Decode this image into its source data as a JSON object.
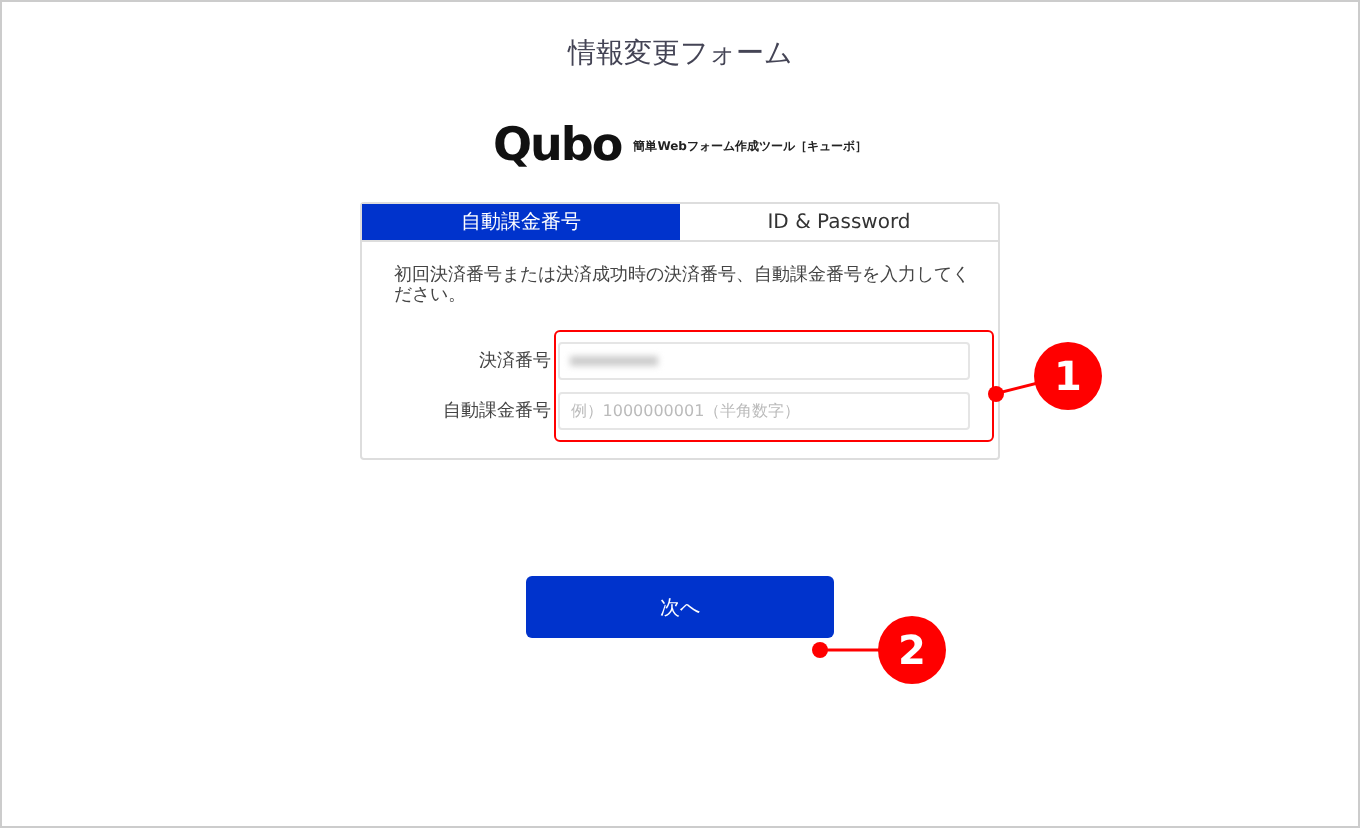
{
  "title": "情報変更フォーム",
  "logo": {
    "name": "Qubo",
    "tagline": "簡単Webフォーム作成ツール［キューボ］"
  },
  "tabs": [
    {
      "label": "自動課金番号",
      "selected": true
    },
    {
      "label": "ID & Password",
      "selected": false
    }
  ],
  "instruction": "初回決済番号または決済成功時の決済番号、自動課金番号を入力してください。",
  "fields": [
    {
      "label": "決済番号",
      "kind": "blurred"
    },
    {
      "label": "自動課金番号",
      "kind": "empty",
      "placeholder": "例）1000000001（半角数字）"
    }
  ],
  "next_button": "次へ",
  "callouts": [
    "1",
    "2"
  ]
}
